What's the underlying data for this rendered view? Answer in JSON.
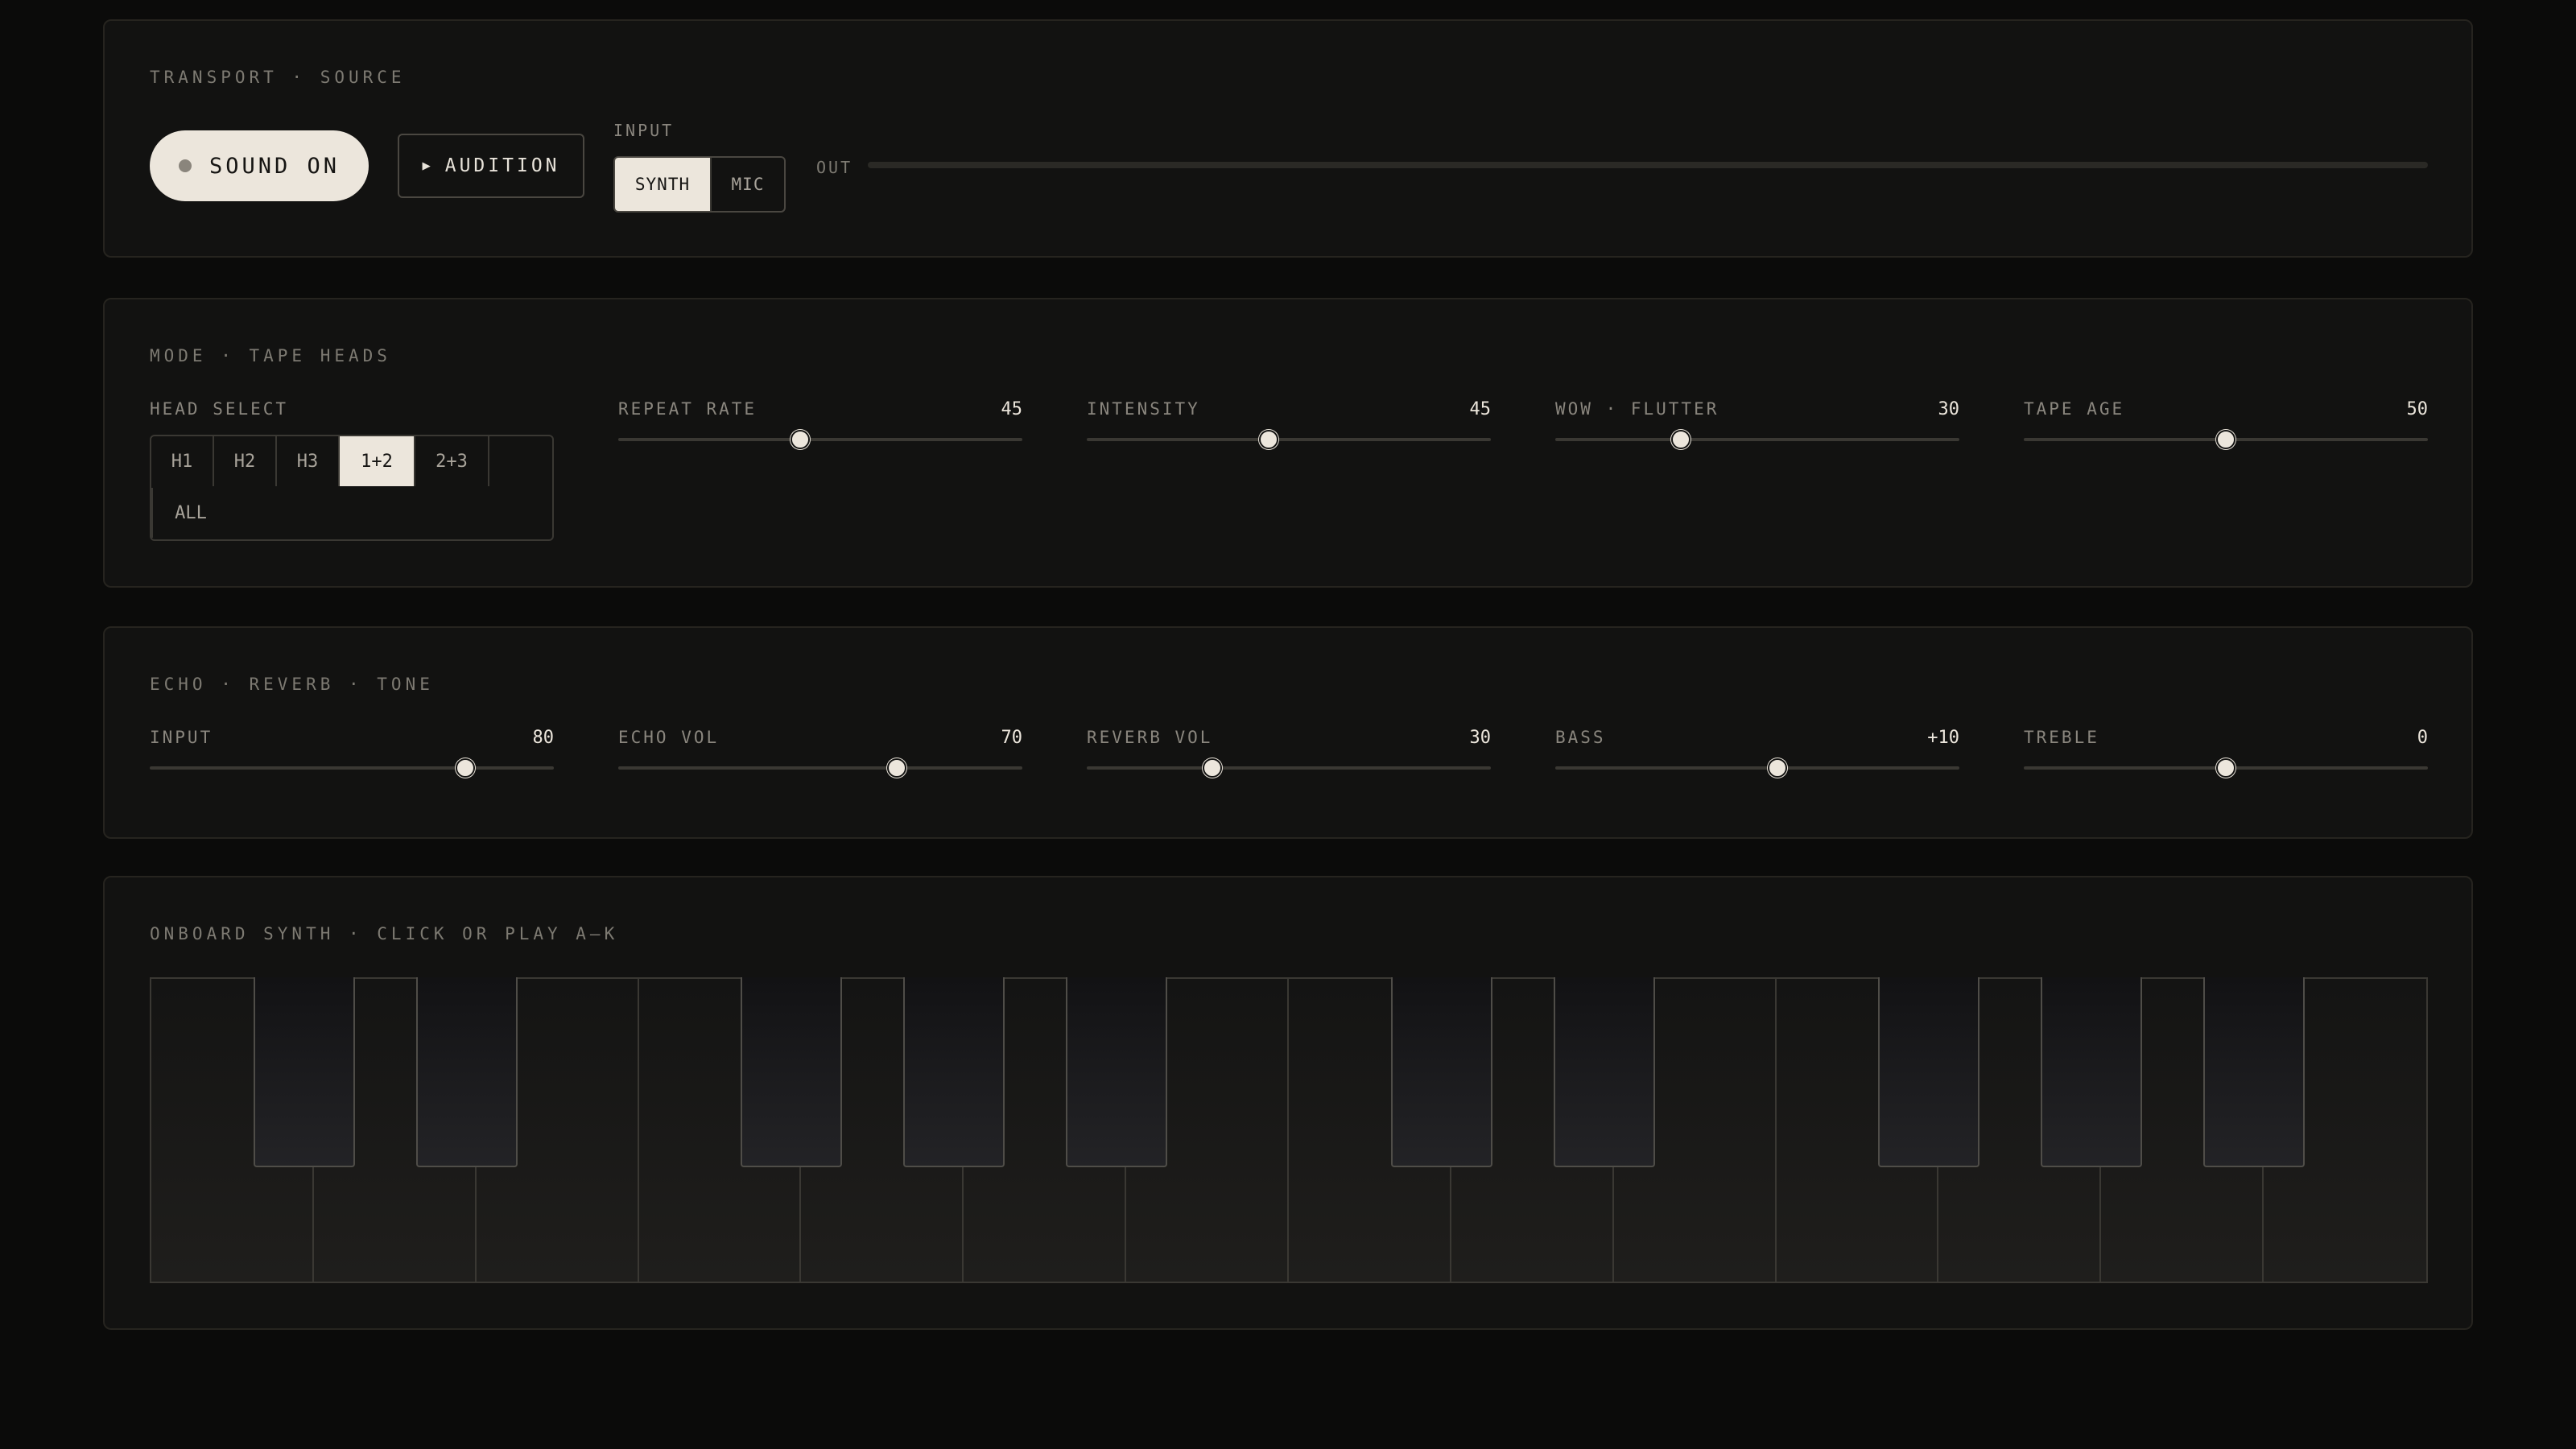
{
  "transport": {
    "title": "TRANSPORT · SOURCE",
    "sound_label": "SOUND ON",
    "audition_icon": "▶",
    "audition_label": "AUDITION",
    "input_label": "INPUT",
    "input_options": [
      "SYNTH",
      "MIC"
    ],
    "input_selected": "SYNTH",
    "out_label": "OUT",
    "out_level": 0
  },
  "mode": {
    "title": "MODE · TAPE HEADS",
    "head_select_label": "HEAD SELECT",
    "heads": [
      "H1",
      "H2",
      "H3",
      "1+2",
      "2+3",
      "ALL"
    ],
    "head_selected": "1+2",
    "sliders": [
      {
        "label": "REPEAT RATE",
        "value": "45",
        "fraction": 0.45
      },
      {
        "label": "INTENSITY",
        "value": "45",
        "fraction": 0.45
      },
      {
        "label": "WOW · FLUTTER",
        "value": "30",
        "fraction": 0.31
      },
      {
        "label": "TAPE AGE",
        "value": "50",
        "fraction": 0.5
      }
    ]
  },
  "echo": {
    "title": "ECHO · REVERB · TONE",
    "sliders": [
      {
        "label": "INPUT",
        "value": "80",
        "fraction": 0.78
      },
      {
        "label": "ECHO VOL",
        "value": "70",
        "fraction": 0.69
      },
      {
        "label": "REVERB VOL",
        "value": "30",
        "fraction": 0.31
      },
      {
        "label": "BASS",
        "value": "+10",
        "fraction": 0.55
      },
      {
        "label": "TREBLE",
        "value": "0",
        "fraction": 0.5
      }
    ]
  },
  "synth": {
    "title": "ONBOARD SYNTH · CLICK OR PLAY A–K",
    "white_key_count": 14,
    "black_keys_after_white": [
      0,
      1,
      3,
      4,
      5,
      7,
      8,
      10,
      11,
      12
    ]
  },
  "colors": {
    "background": "#0b0b0a",
    "panel": "#121211",
    "accent": "#ece6dc"
  }
}
